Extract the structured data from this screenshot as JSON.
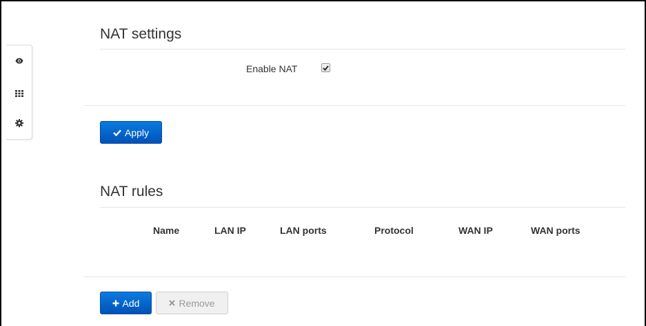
{
  "sidebar": {
    "icons": [
      "eye-icon",
      "grid-icon",
      "gear-icon"
    ]
  },
  "nat_settings": {
    "title": "NAT settings",
    "enable_label": "Enable NAT",
    "enable_checked": true,
    "apply_label": "Apply"
  },
  "nat_rules": {
    "title": "NAT rules",
    "columns": [
      "Name",
      "LAN IP",
      "LAN ports",
      "Protocol",
      "WAN IP",
      "WAN ports"
    ],
    "add_label": "Add",
    "remove_label": "Remove"
  },
  "colors": {
    "primary": "#0a6fd6",
    "disabled_text": "#9a9a9a"
  }
}
